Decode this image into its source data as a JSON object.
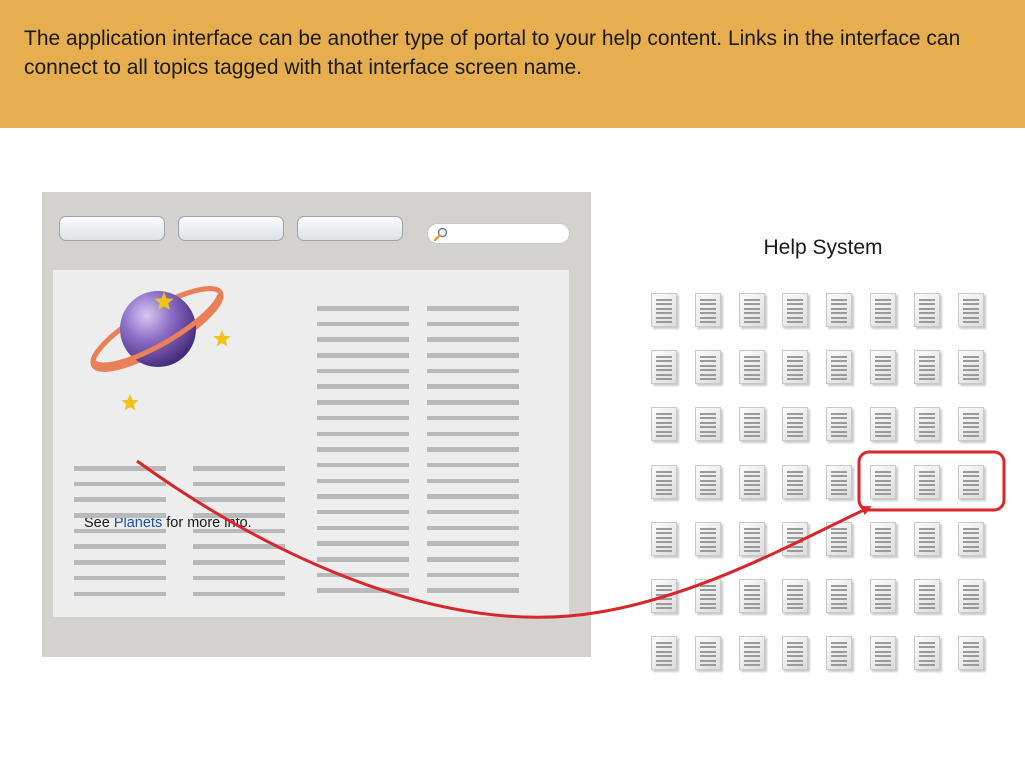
{
  "banner": {
    "text": "The application interface can be another type of portal to your help content. Links in the interface can connect to all topics tagged with that interface screen name.",
    "color": "#E6AE4E"
  },
  "app_window": {
    "toolbar_buttons": 3,
    "search_icon": "magnifier-icon",
    "illustration": "planet-icon",
    "caption": {
      "prefix": "See ",
      "link_text": "Planets",
      "suffix": " for more info."
    },
    "link_color": "#1E4FA0"
  },
  "help_system": {
    "title": "Help System",
    "rows": 7,
    "columns": 8,
    "highlighted": {
      "row": 4,
      "columns": [
        6,
        7,
        8
      ]
    }
  },
  "connector": {
    "from": "Planets link",
    "to": "highlighted help topics",
    "color": "#D9262C"
  }
}
